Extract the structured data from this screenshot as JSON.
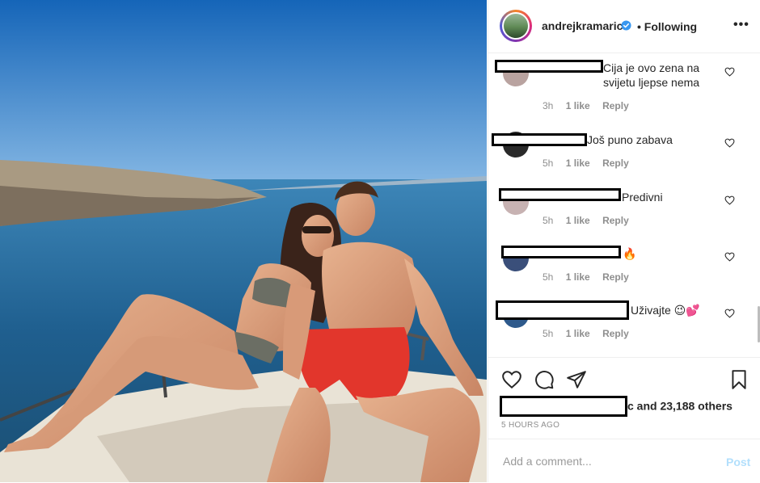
{
  "header": {
    "username": "andrejkramaric",
    "following": "• Following",
    "more_icon": "•••"
  },
  "comments": [
    {
      "text": "Cija je ovo zena na svijetu ljepse nema",
      "time": "3h",
      "likes": "1 like",
      "reply": "Reply"
    },
    {
      "text": "Još puno zabava",
      "time": "5h",
      "likes": "1 like",
      "reply": "Reply"
    },
    {
      "text": "Predivni",
      "time": "5h",
      "likes": "1 like",
      "reply": "Reply"
    },
    {
      "text": "🔥",
      "time": "5h",
      "likes": "1 like",
      "reply": "Reply"
    },
    {
      "text": "Uživajte 😉💕",
      "time": "5h",
      "likes": "1 like",
      "reply": "Reply"
    }
  ],
  "post": {
    "likes_text": "c and 23,188 others",
    "timestamp": "5 HOURS AGO"
  },
  "add_comment": {
    "placeholder": "Add a comment...",
    "post_label": "Post"
  },
  "icons": {
    "like": "heart-icon",
    "comment": "comment-icon",
    "share": "share-icon",
    "save": "bookmark-icon",
    "verified": "verified-badge-icon"
  },
  "colors": {
    "verified": "#3897f0",
    "post_button_disabled": "#b2dffc",
    "meta_gray": "#8e8e8e"
  }
}
